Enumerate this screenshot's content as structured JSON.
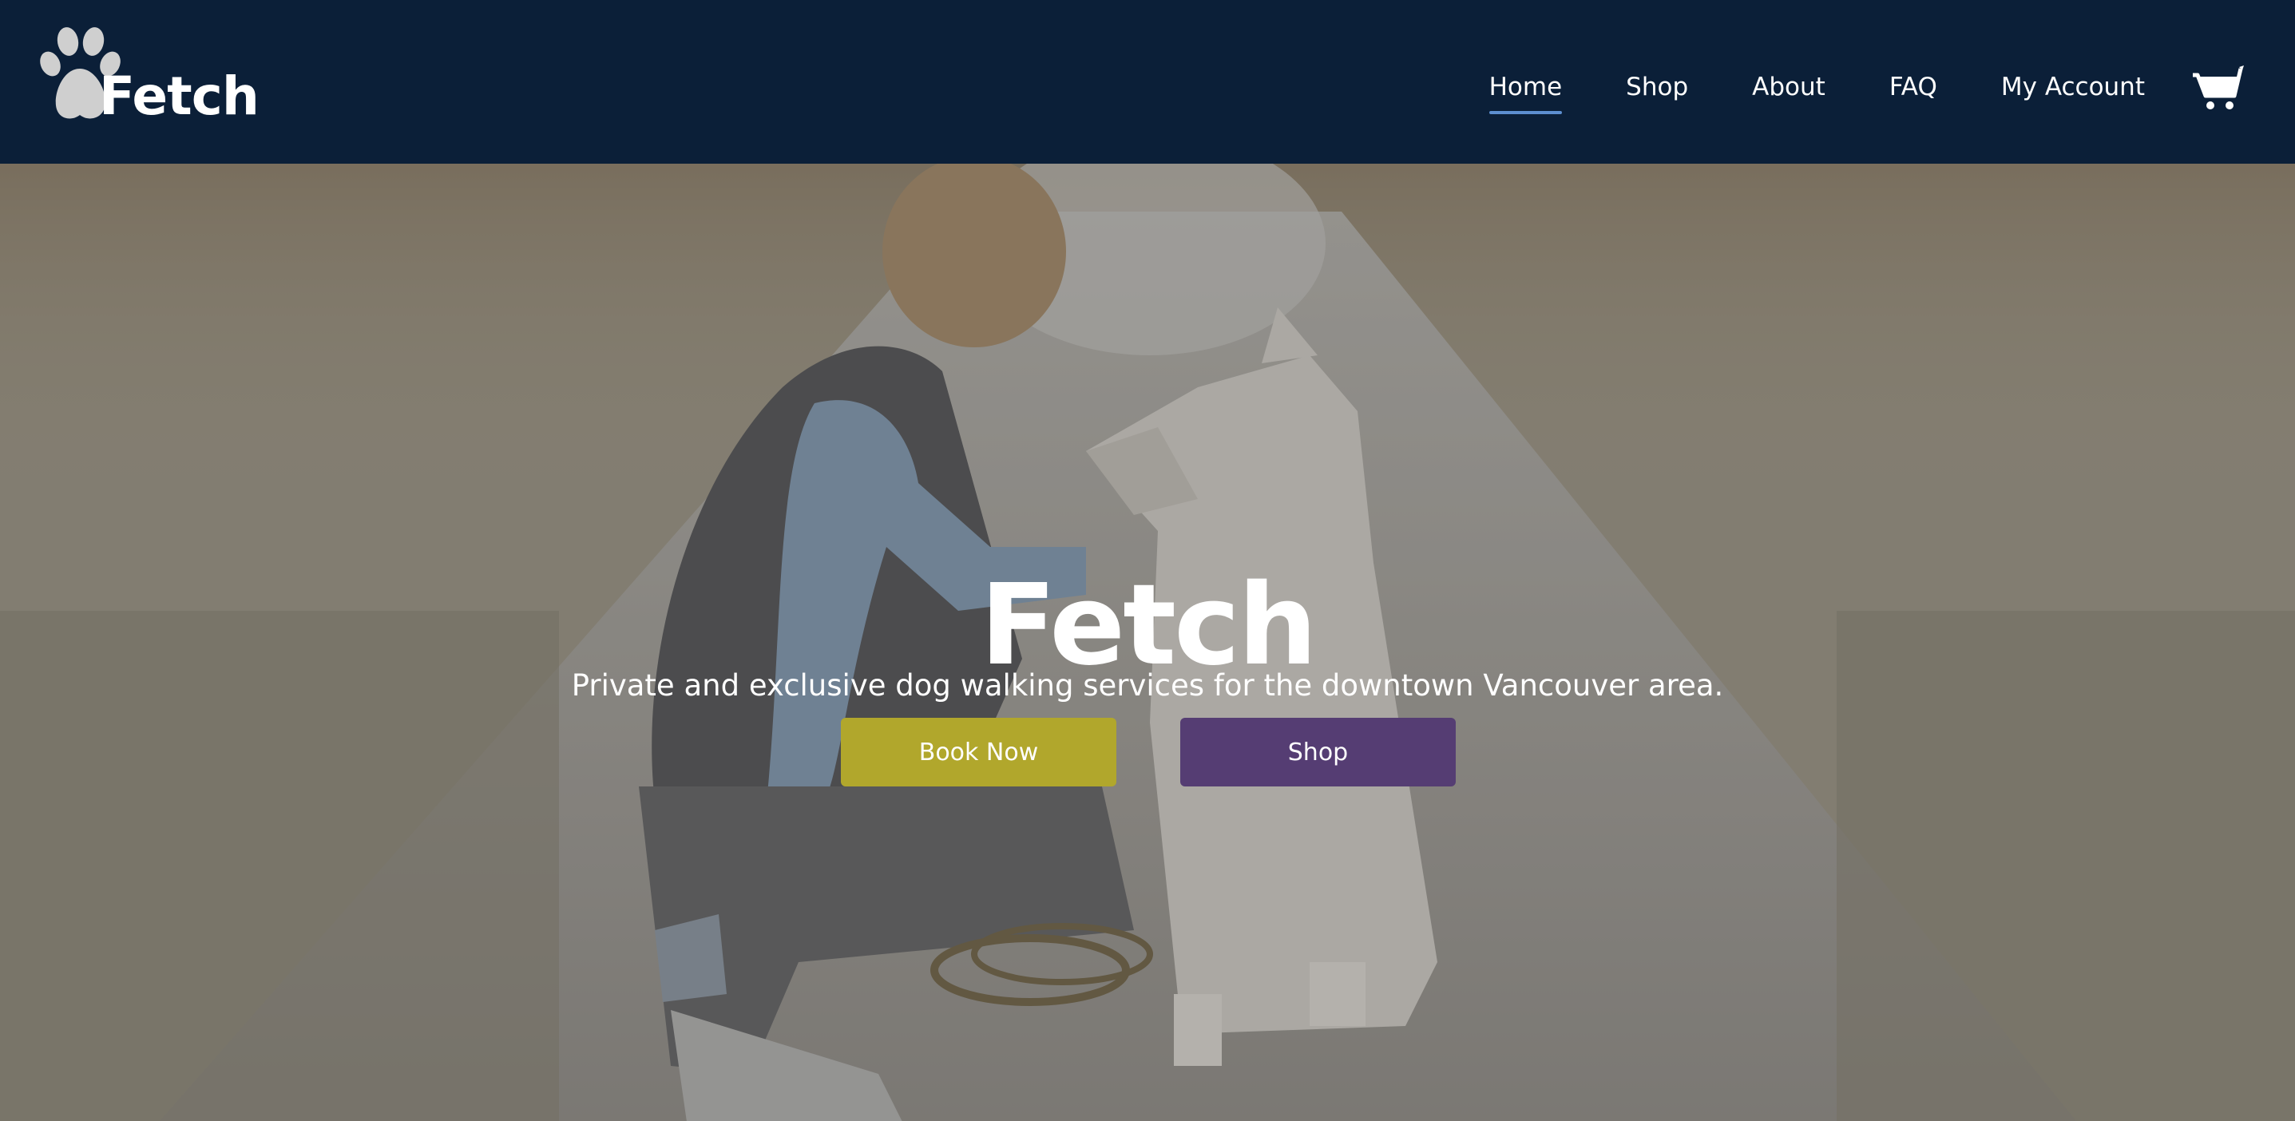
{
  "brand": {
    "name": "Fetch",
    "logo_icon": "paw-icon"
  },
  "nav": {
    "items": [
      {
        "label": "Home",
        "active": true
      },
      {
        "label": "Shop",
        "active": false
      },
      {
        "label": "About",
        "active": false
      },
      {
        "label": "FAQ",
        "active": false
      },
      {
        "label": "My Account",
        "active": false
      }
    ],
    "cart_icon": "shopping-cart-icon"
  },
  "hero": {
    "title": "Fetch",
    "subtitle": "Private and exclusive dog walking services for the downtown Vancouver area.",
    "book_button": "Book Now",
    "shop_button": "Shop"
  },
  "colors": {
    "navbar_bg": "#0b1f38",
    "active_underline": "#5d8fd0",
    "book_button": "#b1a72c",
    "shop_button": "#553d73"
  }
}
